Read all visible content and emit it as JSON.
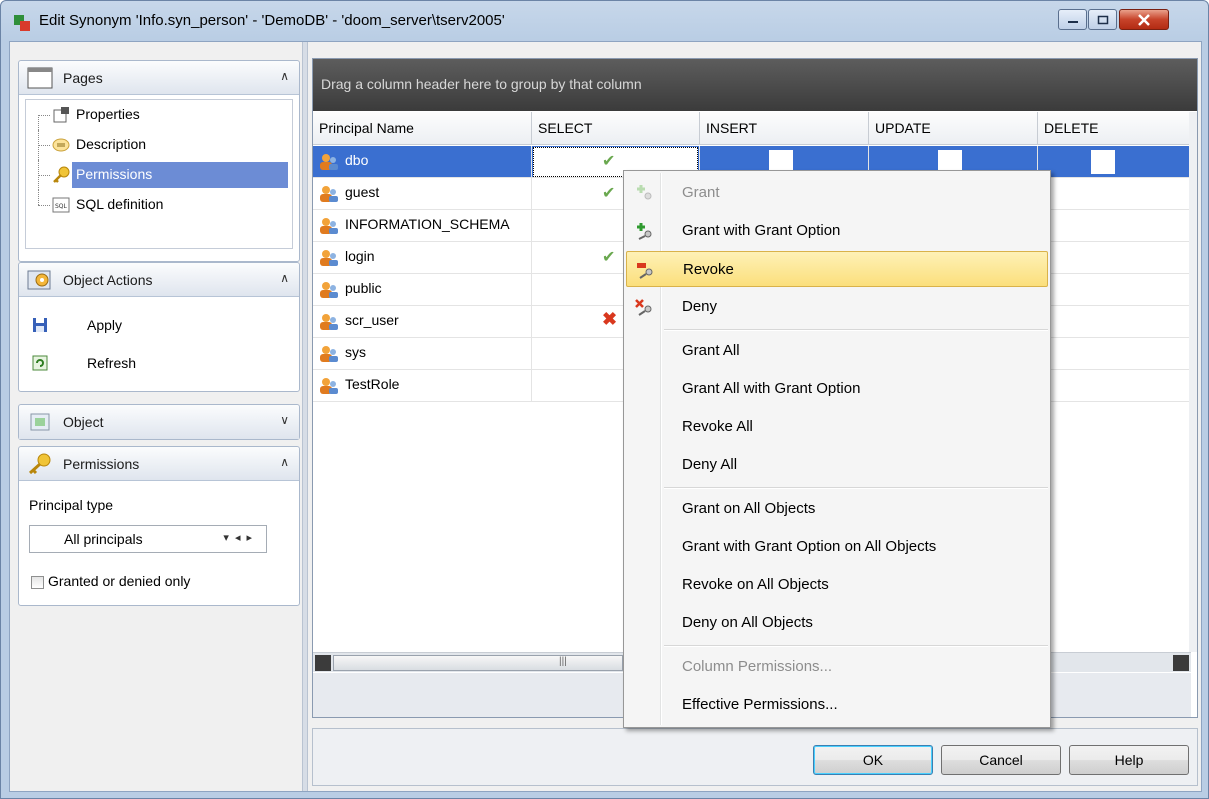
{
  "window": {
    "title": "Edit Synonym 'Info.syn_person' - 'DemoDB' - 'doom_server\\tserv2005'"
  },
  "pages_panel": {
    "title": "Pages",
    "items": [
      {
        "label": "Properties"
      },
      {
        "label": "Description"
      },
      {
        "label": "Permissions"
      },
      {
        "label": "SQL definition"
      }
    ],
    "selected": "Permissions"
  },
  "actions_panel": {
    "title": "Object Actions",
    "items": [
      {
        "label": "Apply"
      },
      {
        "label": "Refresh"
      }
    ]
  },
  "object_panel": {
    "title": "Object"
  },
  "permissions_panel": {
    "title": "Permissions",
    "principal_type_label": "Principal type",
    "principal_type_value": "All principals",
    "granted_only_label": "Granted or denied only"
  },
  "grid": {
    "group_hint": "Drag a column header here to group by that column",
    "columns": [
      "Principal Name",
      "SELECT",
      "INSERT",
      "UPDATE",
      "DELETE"
    ],
    "rows": [
      {
        "name": "dbo",
        "select": "granted"
      },
      {
        "name": "guest",
        "select": "granted"
      },
      {
        "name": "INFORMATION_SCHEMA",
        "select": ""
      },
      {
        "name": "login",
        "select": "granted"
      },
      {
        "name": "public",
        "select": ""
      },
      {
        "name": "scr_user",
        "select": "denied"
      },
      {
        "name": "sys",
        "select": ""
      },
      {
        "name": "TestRole",
        "select": ""
      }
    ]
  },
  "buttons": {
    "ok": "OK",
    "cancel": "Cancel",
    "help": "Help"
  },
  "context_menu": {
    "items": [
      {
        "label": "Grant",
        "enabled": false
      },
      {
        "label": "Grant with Grant Option",
        "enabled": true
      },
      {
        "label": "Revoke",
        "enabled": true,
        "highlighted": true
      },
      {
        "label": "Deny",
        "enabled": true
      },
      {
        "label": "Grant All",
        "enabled": true
      },
      {
        "label": "Grant All with Grant Option",
        "enabled": true
      },
      {
        "label": "Revoke All",
        "enabled": true
      },
      {
        "label": "Deny All",
        "enabled": true
      },
      {
        "label": "Grant on All Objects",
        "enabled": true
      },
      {
        "label": "Grant with Grant Option on All Objects",
        "enabled": true
      },
      {
        "label": "Revoke on All Objects",
        "enabled": true
      },
      {
        "label": "Deny on All Objects",
        "enabled": true
      },
      {
        "label": "Column Permissions...",
        "enabled": false
      },
      {
        "label": "Effective Permissions...",
        "enabled": true
      }
    ]
  },
  "colors": {
    "selection": "#3a6fd0",
    "menu_highlight": "#fbdf7c",
    "granted": "#6aa84f",
    "denied": "#d9381e"
  }
}
